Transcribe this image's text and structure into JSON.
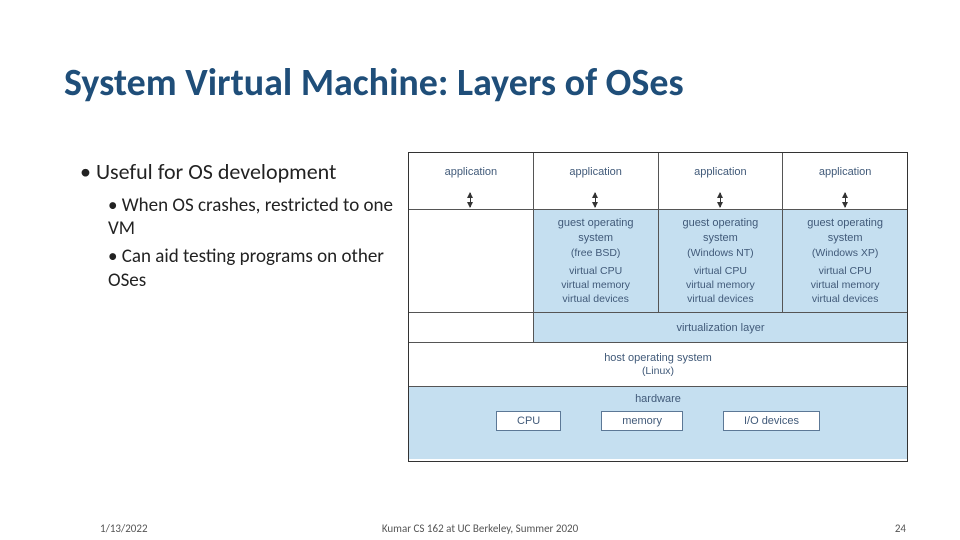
{
  "title": "System Virtual Machine: Layers of OSes",
  "bullets": {
    "b1": "Useful for OS development",
    "b2a": "When OS crashes, restricted to one VM",
    "b2b": "Can aid testing programs on other OSes"
  },
  "diagram": {
    "app": "application",
    "guest_os": "guest operating\nsystem",
    "free_bsd": "(free BSD)",
    "win_nt": "(Windows NT)",
    "win_xp": "(Windows XP)",
    "vcpu": "virtual CPU",
    "vmem": "virtual memory",
    "vdev": "virtual devices",
    "virt_layer": "virtualization layer",
    "host_os": "host operating system",
    "host_os_sub": "(Linux)",
    "hardware": "hardware",
    "cpu": "CPU",
    "memory": "memory",
    "io": "I/O devices"
  },
  "footer": {
    "date": "1/13/2022",
    "center": "Kumar CS 162 at UC Berkeley, Summer 2020",
    "page": "24"
  }
}
